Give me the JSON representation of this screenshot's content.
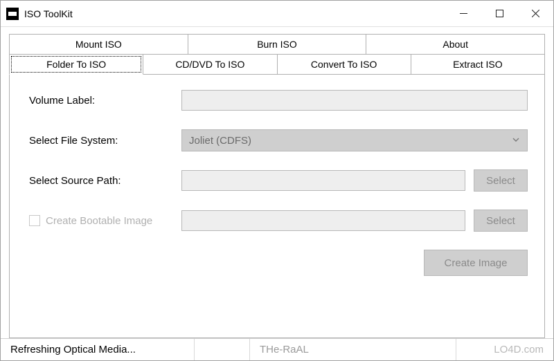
{
  "titlebar": {
    "title": "ISO ToolKit"
  },
  "tabs": {
    "top": [
      {
        "label": "Mount ISO"
      },
      {
        "label": "Burn ISO"
      },
      {
        "label": "About"
      }
    ],
    "bottom": [
      {
        "label": "Folder To ISO",
        "active": true
      },
      {
        "label": "CD/DVD To ISO"
      },
      {
        "label": "Convert To ISO"
      },
      {
        "label": "Extract ISO"
      }
    ]
  },
  "form": {
    "volume_label": "Volume Label:",
    "volume_value": "",
    "filesystem_label": "Select File System:",
    "filesystem_value": "Joliet (CDFS)",
    "source_label": "Select Source Path:",
    "source_value": "",
    "select_btn": "Select",
    "bootable_label": "Create Bootable Image",
    "bootable_value": "",
    "select_btn2": "Select",
    "create_btn": "Create Image"
  },
  "statusbar": {
    "status": "Refreshing Optical Media...",
    "watermark": "THe-RaAL",
    "attribution": "LO4D.com"
  }
}
